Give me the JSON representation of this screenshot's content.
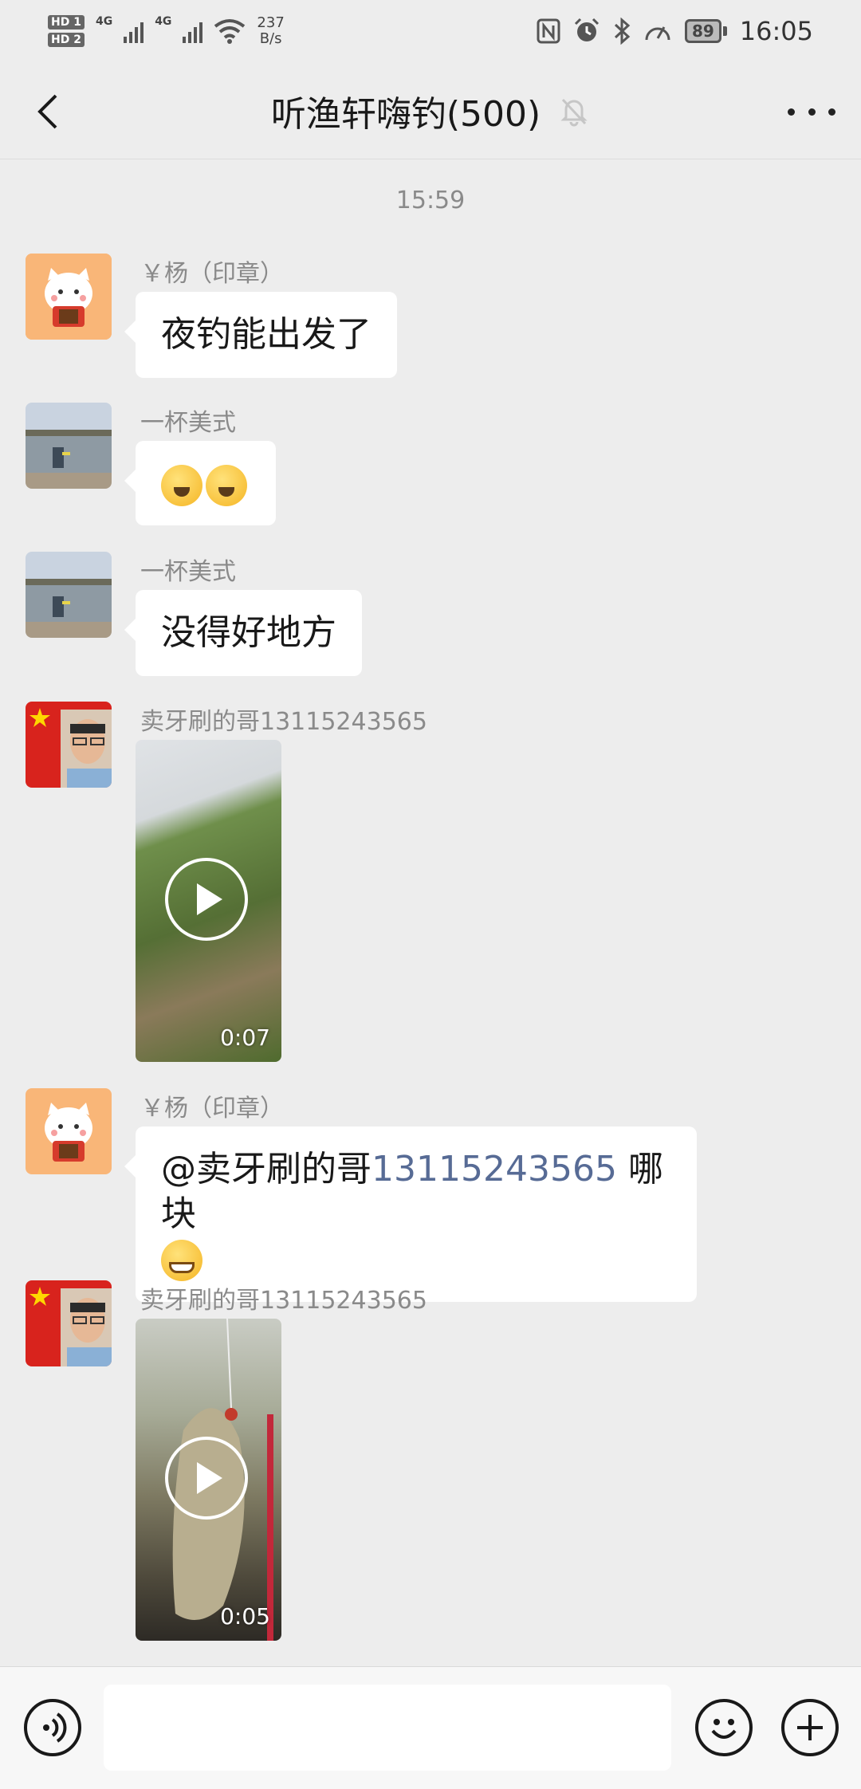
{
  "status_bar": {
    "sim1": "HD 1",
    "sim2": "HD 2",
    "network1": "4G",
    "network2": "4G",
    "net_speed_value": "237",
    "net_speed_unit": "B/s",
    "battery": "89",
    "time": "16:05"
  },
  "header": {
    "title": "听渔轩嗨钓(500)"
  },
  "chat": {
    "time_separator": "15:59",
    "messages": [
      {
        "sender": "￥杨（印章）",
        "type": "text",
        "text": "夜钓能出发了"
      },
      {
        "sender": "一杯美式",
        "type": "emoji",
        "emojis": [
          "zipper-mouth-face",
          "zipper-mouth-face"
        ]
      },
      {
        "sender": "一杯美式",
        "type": "text",
        "text": "没得好地方"
      },
      {
        "sender": "卖牙刷的哥13115243565",
        "type": "video",
        "duration": "0:07"
      },
      {
        "sender": "￥杨（印章）",
        "type": "mention",
        "prefix": "@卖牙刷的哥",
        "mention_number": "13115243565",
        "suffix": "哪块",
        "emoji": "grinning-face"
      },
      {
        "sender": "卖牙刷的哥13115243565",
        "type": "video",
        "duration": "0:05"
      }
    ]
  },
  "input_bar": {
    "placeholder": ""
  },
  "colors": {
    "background": "#ededed",
    "bubble": "#ffffff",
    "mention": "#576b95",
    "sender_text": "#8a8a8a"
  }
}
